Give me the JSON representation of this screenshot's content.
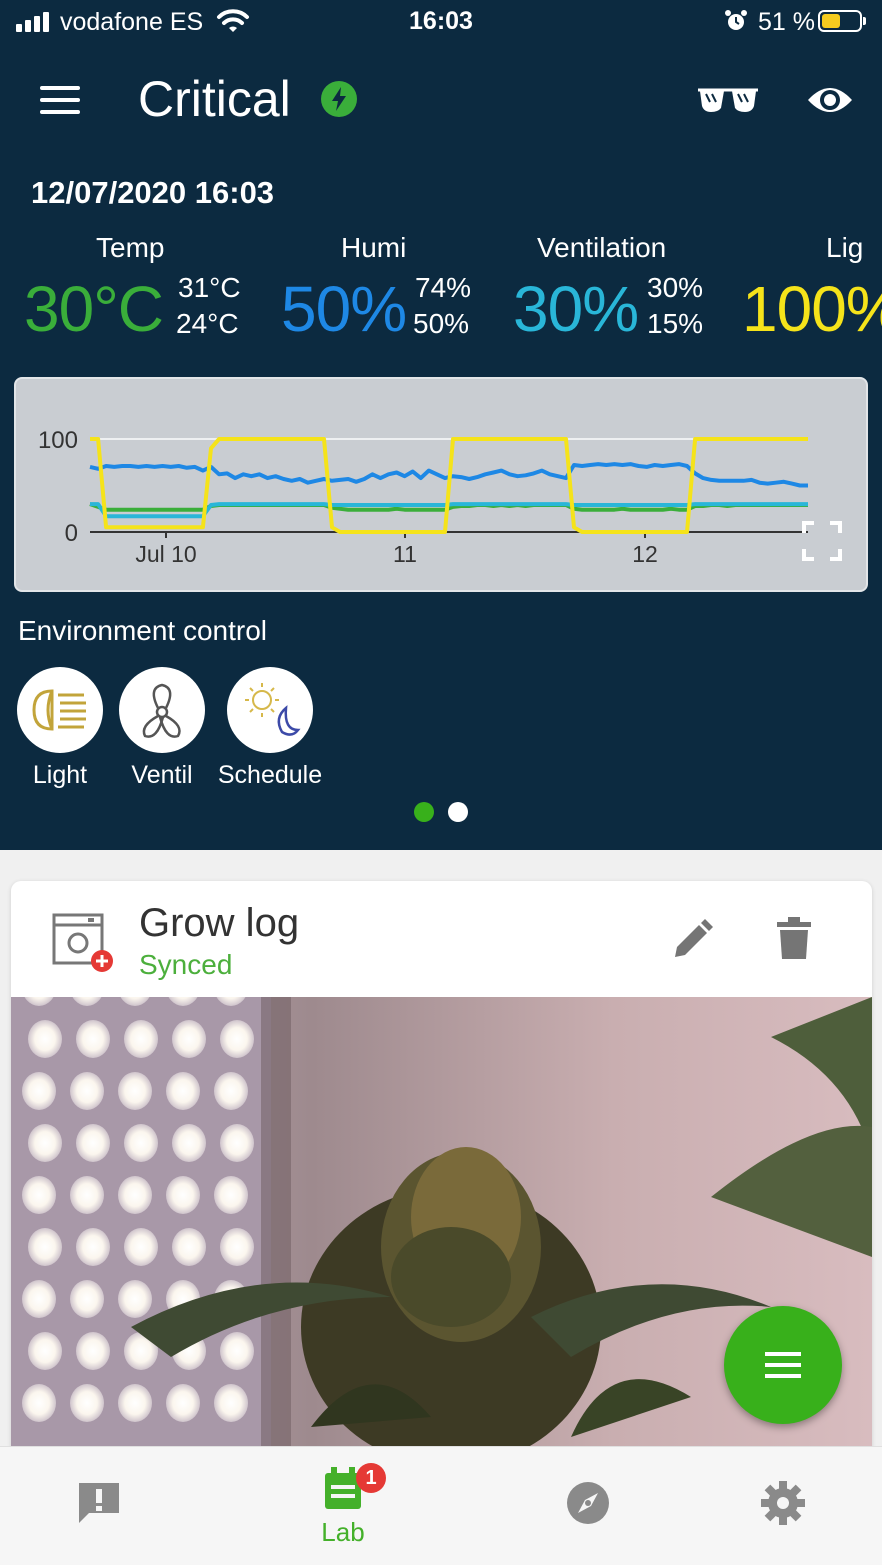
{
  "status_bar": {
    "carrier": "vodafone ES",
    "time": "16:03",
    "battery_percent": "51 %",
    "battery_level": 0.51,
    "battery_color": "#f5cc1f"
  },
  "header": {
    "title": "Critical",
    "status_icon": "lightning-bolt-icon",
    "status_color": "#3aae3a"
  },
  "datetime": "12/07/2020 16:03",
  "metrics": [
    {
      "label": "Temp",
      "value": "30°C",
      "max": "31°C",
      "min": "24°C",
      "color": "#3aae3a"
    },
    {
      "label": "Humi",
      "value": "50%",
      "max": "74%",
      "min": "50%",
      "color": "#1e88e5"
    },
    {
      "label": "Ventilation",
      "value": "30%",
      "max": "30%",
      "min": "15%",
      "color": "#29b6d8"
    },
    {
      "label": "Lig",
      "value": "100%",
      "color": "#f5e31a"
    }
  ],
  "chart_data": {
    "type": "line",
    "y_ticks": [
      "100",
      "0"
    ],
    "ylim": [
      0,
      100
    ],
    "x_ticks": [
      "Jul 10",
      "11",
      "12"
    ],
    "series": [
      {
        "color": "#f5e31a",
        "values": [
          100,
          100,
          5,
          5,
          5,
          5,
          5,
          5,
          5,
          5,
          5,
          5,
          5,
          5,
          5,
          90,
          100,
          100,
          100,
          100,
          100,
          100,
          100,
          100,
          100,
          100,
          100,
          100,
          100,
          100,
          5,
          0,
          0,
          0,
          0,
          0,
          0,
          0,
          0,
          0,
          0,
          0,
          0,
          0,
          0,
          100,
          100,
          100,
          100,
          100,
          100,
          100,
          100,
          100,
          100,
          100,
          100,
          100,
          100,
          100,
          5,
          0,
          0,
          0,
          0,
          0,
          0,
          0,
          0,
          0,
          0,
          0,
          0,
          0,
          0,
          100,
          100,
          100,
          100,
          100,
          100,
          100,
          100,
          100,
          100,
          100,
          100,
          100,
          100,
          100
        ]
      },
      {
        "color": "#1e88e5",
        "values": [
          70,
          68,
          71,
          70,
          71,
          71,
          70,
          71,
          70,
          71,
          70,
          71,
          69,
          70,
          66,
          70,
          62,
          63,
          58,
          62,
          60,
          62,
          58,
          60,
          57,
          55,
          57,
          53,
          55,
          57,
          55,
          56,
          57,
          54,
          57,
          62,
          58,
          62,
          64,
          60,
          65,
          58,
          66,
          62,
          58,
          60,
          59,
          57,
          59,
          62,
          64,
          66,
          62,
          60,
          61,
          63,
          66,
          62,
          60,
          58,
          72,
          71,
          72,
          73,
          72,
          73,
          72,
          73,
          71,
          70,
          72,
          71,
          72,
          73,
          71,
          63,
          58,
          56,
          55,
          55,
          55,
          55,
          56,
          53,
          52,
          53,
          54,
          52,
          50,
          50
        ]
      },
      {
        "color": "#3aae3a",
        "values": [
          30,
          27,
          24,
          24,
          24,
          24,
          24,
          24,
          24,
          24,
          24,
          24,
          24,
          24,
          24,
          28,
          29,
          29,
          29,
          29,
          29,
          29,
          29,
          29,
          29,
          29,
          29,
          29,
          29,
          29,
          26,
          25,
          24,
          24,
          24,
          24,
          24,
          24,
          25,
          24,
          24,
          24,
          24,
          24,
          24,
          27,
          28,
          28,
          29,
          29,
          28,
          29,
          28,
          29,
          28,
          29,
          29,
          29,
          29,
          29,
          25,
          24,
          24,
          24,
          24,
          24,
          25,
          24,
          24,
          24,
          24,
          24,
          25,
          24,
          24,
          28,
          28,
          29,
          29,
          28,
          29,
          29,
          29,
          29,
          29,
          29,
          29,
          29,
          29,
          29
        ]
      },
      {
        "color": "#29b6d8",
        "values": [
          30,
          30,
          17,
          17,
          17,
          17,
          17,
          17,
          17,
          17,
          17,
          17,
          17,
          17,
          17,
          29,
          30,
          30,
          30,
          30,
          30,
          30,
          30,
          30,
          30,
          30,
          30,
          30,
          30,
          30,
          29,
          29,
          29,
          29,
          29,
          29,
          29,
          29,
          29,
          29,
          29,
          29,
          29,
          29,
          29,
          30,
          30,
          30,
          30,
          30,
          30,
          30,
          30,
          30,
          30,
          30,
          30,
          30,
          30,
          30,
          29,
          29,
          29,
          29,
          29,
          29,
          29,
          29,
          29,
          29,
          29,
          29,
          29,
          29,
          29,
          30,
          30,
          30,
          30,
          30,
          30,
          30,
          30,
          30,
          30,
          30,
          30,
          30,
          30,
          30
        ]
      }
    ]
  },
  "environment": {
    "title": "Environment control",
    "items": [
      {
        "label": "Light",
        "icon": "light-beam-icon"
      },
      {
        "label": "Ventil",
        "icon": "fan-icon"
      },
      {
        "label": "Schedule",
        "icon": "sun-moon-icon"
      }
    ],
    "pager": {
      "count": 2,
      "active": 0,
      "active_color": "#38b01b"
    }
  },
  "grow_log": {
    "title": "Grow log",
    "subtitle": "Synced",
    "subtitle_color": "#4caf3c"
  },
  "bottom_nav": [
    {
      "name": "alerts",
      "icon": "alert-message-icon",
      "label": ""
    },
    {
      "name": "lab",
      "icon": "lab-clipboard-icon",
      "label": "Lab",
      "badge": "1",
      "active": true
    },
    {
      "name": "explore",
      "icon": "compass-icon",
      "label": ""
    },
    {
      "name": "settings",
      "icon": "gear-icon",
      "label": ""
    }
  ]
}
